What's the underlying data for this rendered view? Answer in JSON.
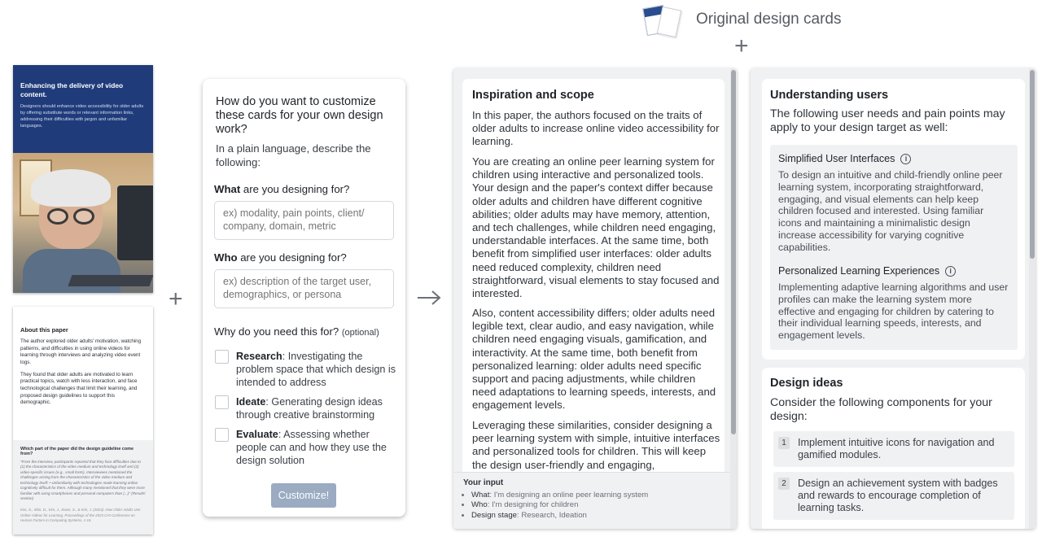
{
  "header": {
    "title": "Original design cards"
  },
  "left_cards": {
    "card_a": {
      "title": "Enhancing the delivery of video content.",
      "body": "Designers should enhance video accessibility for older adults by offering substitute words or relevant information links, addressing their difficulties with jargon and unfamiliar languages."
    },
    "card_b": {
      "title": "About this paper",
      "p1": "The author explored older adults' motivation, watching patterns, and difficulties in using online videos for learning through interviews and analyzing video event logs.",
      "p2": "They found that older adults are motivated to learn practical topics, watch with less interaction, and face technological challenges that limit their learning, and proposed design guidelines to support this demographic.",
      "question": "Which part of the paper did the design guideline come from?",
      "quote": "\"From the interview, participants reported that they face difficulties due to (1) the characteristics of the video medium and technology itself and (2) video-specific issues (e.g., small fonts). Interviewees mentioned the challenges arising from the characteristics of the video medium and technology itself: • Unfamiliarity with technologies made learning online cognitively difficult for them. Although many mentioned that they were more familiar with using smartphones and personal computers than (...)\" (Results' section)",
      "citation": "Kim, S., Shin, D., Kim, J., Kwon, S., & Kim, J. (2023). How Older Adults Use Online Videos for Learning. Proceedings of the 2023 CHI Conference on Human Factors in Computing Systems, 1-16."
    }
  },
  "form": {
    "title": "How do you want to customize these cards for your own design work?",
    "subtitle": "In a plain language, describe the following:",
    "what_label_bold": "What",
    "what_label_rest": " are you designing for?",
    "what_placeholder": "ex) modality, pain points, client/ company, domain, metric",
    "who_label_bold": "Who",
    "who_label_rest": " are you designing for?",
    "who_placeholder": "ex) description of the target user, demographics, or persona",
    "why_label": "Why do you need this for?",
    "why_optional": "(optional)",
    "options": [
      {
        "name": "Research",
        "desc": ": Investigating the problem space that which design is intended to address"
      },
      {
        "name": "Ideate",
        "desc": ": Generating design ideas through creative brainstorming"
      },
      {
        "name": "Evaluate",
        "desc": ": Assessing whether people can and how they use the design solution"
      }
    ],
    "button": "Customize!"
  },
  "output_left": {
    "heading": "Inspiration and scope",
    "p1": "In this paper, the authors focused on the traits of older adults to increase online video accessibility for learning.",
    "p2": "You are creating an online peer learning system for children using interactive and personalized tools. Your design and the paper's context differ because older adults and children have different cognitive abilities; older adults may have memory, attention, and tech challenges, while children need engaging, understandable interfaces. At the same time, both benefit from simplified user interfaces: older adults need reduced complexity, children need straightforward, visual elements to stay focused and interested.",
    "p3": "Also, content accessibility differs; older adults need legible text, clear audio, and easy navigation, while children need engaging visuals, gamification, and interactivity. At the same time, both benefit from personalized learning: older adults need specific support and pacing adjustments, while children need adaptations to learning speeds, interests, and engagement levels.",
    "p4": "Leveraging these similarities, consider designing a peer learning system with simple, intuitive interfaces and personalized tools for children. This will keep the design user-friendly and engaging,",
    "input_title": "Your input",
    "inputs": [
      {
        "key": "What",
        "value": ": I'm designing an online peer learning system"
      },
      {
        "key": "Who",
        "value": ": I'm designing for children"
      },
      {
        "key": "Design stage",
        "value": ": Research, Ideation"
      }
    ]
  },
  "output_right": {
    "users_heading": "Understanding users",
    "users_intro": "The following user needs and pain points may apply to your design target as well:",
    "needs": [
      {
        "title": "Simplified User Interfaces",
        "body": "To design an intuitive and child-friendly online peer learning system, incorporating straightforward, engaging, and visual elements can help keep children focused and interested. Using familiar icons and maintaining a minimalistic design increase accessibility for varying cognitive capabilities."
      },
      {
        "title": "Personalized Learning Experiences",
        "body": "Implementing adaptive learning algorithms and user profiles can make the learning system more effective and engaging for children by catering to their individual learning speeds, interests, and engagement levels."
      }
    ],
    "ideas_heading": "Design ideas",
    "ideas_intro": "Consider the following components for your design:",
    "ideas": [
      {
        "num": "1",
        "text": "Implement intuitive icons for navigation and gamified modules."
      },
      {
        "num": "2",
        "text": "Design an achievement system with badges and rewards to encourage completion of learning tasks."
      }
    ]
  }
}
